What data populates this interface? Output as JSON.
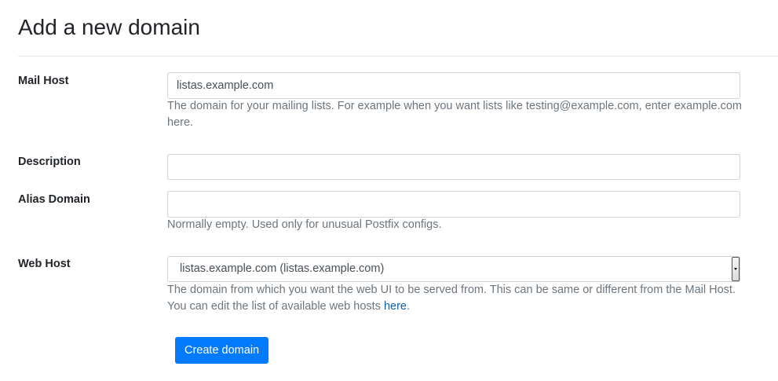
{
  "page": {
    "title": "Add a new domain"
  },
  "form": {
    "mail_host": {
      "label": "Mail Host",
      "value": "listas.example.com",
      "help": "The domain for your mailing lists. For example when you want lists like testing@example.com, enter example.com here."
    },
    "description": {
      "label": "Description",
      "value": ""
    },
    "alias_domain": {
      "label": "Alias Domain",
      "value": "",
      "help": "Normally empty. Used only for unusual Postfix configs."
    },
    "web_host": {
      "label": "Web Host",
      "selected": "listas.example.com (listas.example.com)",
      "help_before_link": "The domain from which you want the web UI to be served from. This can be same or different from the Mail Host. You can edit the list of available web hosts ",
      "help_link": "here",
      "help_after_link": "."
    },
    "submit_label": "Create domain"
  }
}
